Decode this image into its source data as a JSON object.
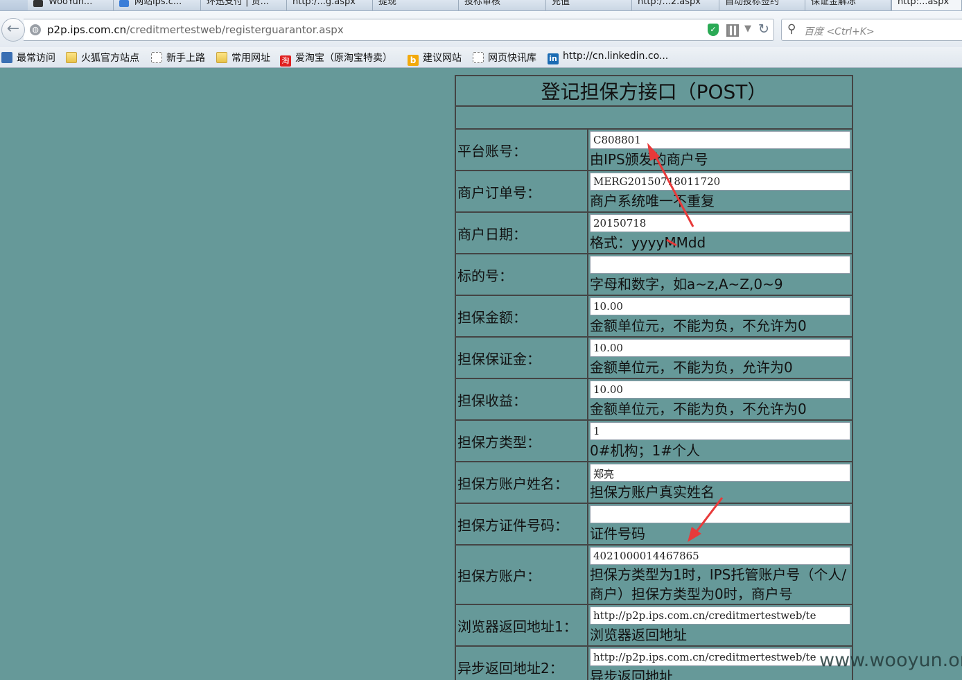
{
  "tabs": [
    {
      "label": "WooYun..."
    },
    {
      "label": "网站ips.c..."
    },
    {
      "label": "环迅支付 | 贷..."
    },
    {
      "label": "http:/...g.aspx"
    },
    {
      "label": "提现"
    },
    {
      "label": "投标审核"
    },
    {
      "label": "充值"
    },
    {
      "label": "http:/...2.aspx"
    },
    {
      "label": "自动投标签约"
    },
    {
      "label": "保证金解冻"
    },
    {
      "label": "http:...aspx"
    }
  ],
  "address": {
    "host": "p2p.ips.com.cn",
    "path": "/creditmertestweb/registerguarantor.aspx"
  },
  "search": {
    "placeholder": "百度 <Ctrl+K>"
  },
  "bookmarks": [
    {
      "label": "最常访问"
    },
    {
      "label": "火狐官方站点"
    },
    {
      "label": "新手上路"
    },
    {
      "label": "常用网址"
    },
    {
      "label": "爱淘宝（原淘宝特卖）"
    },
    {
      "label": "建议网站"
    },
    {
      "label": "网页快讯库"
    },
    {
      "label": "http://cn.linkedin.co..."
    }
  ],
  "form": {
    "title": "登记担保方接口（POST）",
    "rows": [
      {
        "label": "平台账号：",
        "value": "C808801",
        "hint": "由IPS颁发的商户号"
      },
      {
        "label": "商户订单号：",
        "value": "MERG20150718011720",
        "hint": "商户系统唯一不重复"
      },
      {
        "label": "商户日期：",
        "value": "20150718",
        "hint": "格式：yyyyMMdd"
      },
      {
        "label": "标的号：",
        "value": "",
        "hint": "字母和数字，如a~z,A~Z,0~9"
      },
      {
        "label": "担保金额：",
        "value": "10.00",
        "hint": "金额单位元，不能为负，不允许为0"
      },
      {
        "label": "担保保证金：",
        "value": "10.00",
        "hint": "金额单位元，不能为负，允许为0"
      },
      {
        "label": "担保收益：",
        "value": "10.00",
        "hint": "金额单位元，不能为负，不允许为0"
      },
      {
        "label": "担保方类型：",
        "value": "1",
        "hint": "0#机构；1#个人"
      },
      {
        "label": "担保方账户姓名：",
        "value": "郑亮",
        "hint": "担保方账户真实姓名"
      },
      {
        "label": "担保方证件号码：",
        "value": "",
        "hint": "证件号码"
      },
      {
        "label": "担保方账户：",
        "value": "4021000014467865",
        "hint": "担保方类型为1时，IPS托管账户号（个人/商户）担保方类型为0时，商户号"
      },
      {
        "label": "浏览器返回地址1：",
        "value": "http://p2p.ips.com.cn/creditmertestweb/te",
        "hint": "浏览器返回地址"
      },
      {
        "label": "异步返回地址2：",
        "value": "http://p2p.ips.com.cn/creditmertestweb/te",
        "hint": "异步返回地址"
      }
    ]
  },
  "watermark": "www.wooyun.org",
  "colors": {
    "page_bg": "#669999",
    "arrow": "#e83a3a"
  }
}
